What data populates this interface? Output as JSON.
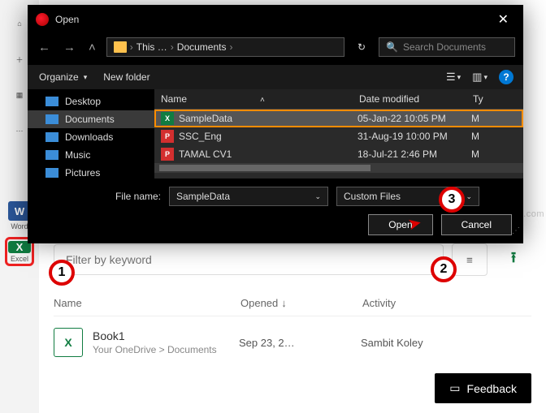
{
  "sidebar": {
    "word_label": "Word",
    "excel_label": "Excel"
  },
  "excel_page": {
    "filter_placeholder": "Filter by keyword",
    "columns": {
      "name": "Name",
      "opened": "Opened",
      "activity": "Activity"
    },
    "row": {
      "name": "Book1",
      "path": "Your OneDrive > Documents",
      "opened": "Sep 23, 2…",
      "activity": "Sambit Koley"
    }
  },
  "feedback_label": "Feedback",
  "dialog": {
    "title": "Open",
    "breadcrumb": {
      "root": "This …",
      "folder": "Documents"
    },
    "search_placeholder": "Search Documents",
    "organize": "Organize",
    "new_folder": "New folder",
    "tree": {
      "desktop": "Desktop",
      "documents": "Documents",
      "downloads": "Downloads",
      "music": "Music",
      "pictures": "Pictures"
    },
    "columns": {
      "name": "Name",
      "date": "Date modified",
      "type": "Ty"
    },
    "files": [
      {
        "name": "SampleData",
        "date": "05-Jan-22 10:05 PM",
        "type": "M",
        "icon": "xlsx"
      },
      {
        "name": "SSC_Eng",
        "date": "31-Aug-19 10:00 PM",
        "type": "M",
        "icon": "pdf"
      },
      {
        "name": "TAMAL CV1",
        "date": "18-Jul-21 2:46 PM",
        "type": "M",
        "icon": "pdf"
      }
    ],
    "filename_label": "File name:",
    "filename_value": "SampleData",
    "filetype_value": "Custom Files",
    "open_btn": "Open",
    "cancel_btn": "Cancel"
  },
  "annotations": {
    "a1": "1",
    "a2": "2",
    "a3": "3"
  },
  "watermark": "thegeekpage.com"
}
